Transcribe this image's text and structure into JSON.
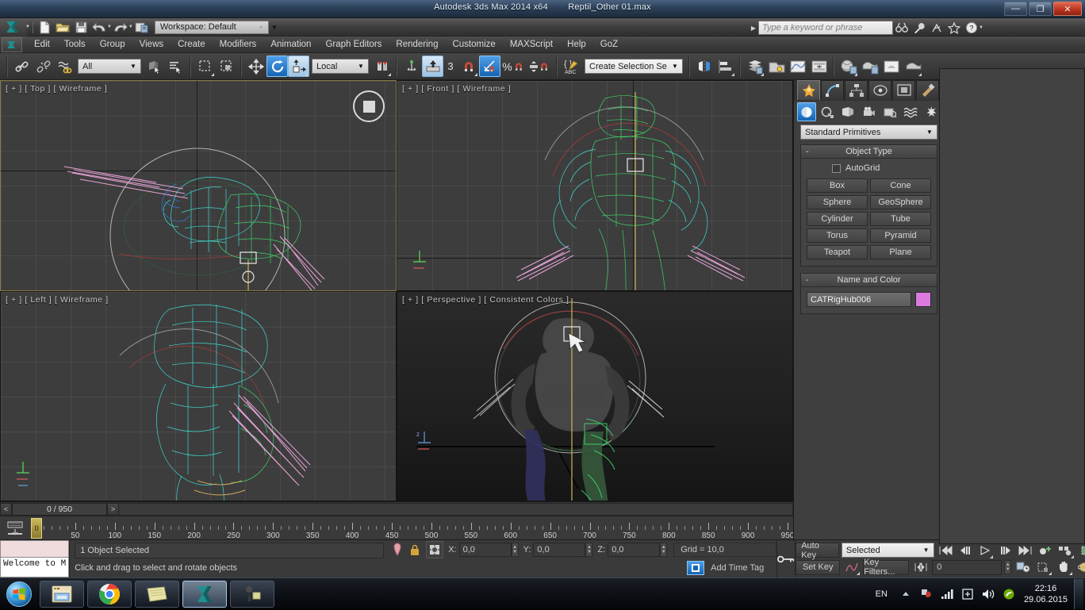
{
  "window": {
    "title_app": "Autodesk 3ds Max  2014 x64",
    "title_file": "Reptil_Other 01.max",
    "minimize_label": "—",
    "restore_label": "❐",
    "close_label": "✕"
  },
  "quick_access": {
    "workspace_label": "Workspace: Default",
    "workspace_dash": "-",
    "icons": [
      "new-file-icon",
      "open-file-icon",
      "save-icon",
      "undo-icon",
      "redo-icon",
      "project-folder-icon"
    ],
    "search_placeholder": "Type a keyword or phrase",
    "search_value": "",
    "right_icons": [
      "binoculars-icon",
      "wrench-icon",
      "subscription-icon",
      "favorites-star-icon",
      "help-icon"
    ]
  },
  "menu": {
    "items": [
      "Edit",
      "Tools",
      "Group",
      "Views",
      "Create",
      "Modifiers",
      "Animation",
      "Graph Editors",
      "Rendering",
      "Customize",
      "MAXScript",
      "Help",
      "GoZ"
    ]
  },
  "toolbar": {
    "selection_filter": "All",
    "reference_coord": "Local",
    "named_selection_sets": "Create Selection Se",
    "angle_snap_value": "3",
    "percent_label": "%",
    "icons": [
      "select-and-link-icon",
      "unlink-selection-icon",
      "bind-to-space-warp-icon",
      "select-object-icon",
      "select-by-name-icon",
      "rectangular-selection-region-icon",
      "window-crossing-icon",
      "select-and-move-icon",
      "select-and-rotate-icon",
      "select-and-scale-icon",
      "use-center-flyout-icon",
      "select-and-manipulate-icon",
      "snaps-toggle-icon",
      "angle-snap-toggle-icon",
      "percent-snap-toggle-icon",
      "spinner-snap-toggle-icon",
      "edit-named-selection-sets-icon",
      "mirror-icon",
      "align-icon",
      "layer-manager-icon",
      "graphite-modeling-icon",
      "curve-editor-icon",
      "schematic-view-icon",
      "material-editor-icon",
      "render-setup-icon",
      "rendered-frame-window-icon",
      "render-production-icon"
    ]
  },
  "viewports": [
    {
      "name": "viewport-top",
      "label": "[ + ] [ Top ] [ Wireframe ]",
      "active": true
    },
    {
      "name": "viewport-front",
      "label": "[ + ] [ Front ] [ Wireframe ]",
      "active": false
    },
    {
      "name": "viewport-left",
      "label": "[ + ] [ Left ] [ Wireframe ]",
      "active": false
    },
    {
      "name": "viewport-perspective",
      "label": "[ + ] [ Perspective ] [ Consistent Colors ]",
      "active": false
    }
  ],
  "command_panel": {
    "tabs": [
      "create-tab",
      "modify-tab",
      "hierarchy-tab",
      "motion-tab",
      "display-tab",
      "utilities-tab"
    ],
    "categories": [
      "geometry-category",
      "shapes-category",
      "lights-category",
      "cameras-category",
      "helpers-category",
      "space-warps-category",
      "systems-category"
    ],
    "subcategory": "Standard Primitives",
    "object_type": {
      "header": "Object Type",
      "collapse_glyph": "-",
      "autogrid_label": "AutoGrid",
      "autogrid_checked": false,
      "buttons": [
        "Box",
        "Cone",
        "Sphere",
        "GeoSphere",
        "Cylinder",
        "Tube",
        "Torus",
        "Pyramid",
        "Teapot",
        "Plane"
      ]
    },
    "name_and_color": {
      "header": "Name and Color",
      "collapse_glyph": "-",
      "object_name": "CATRigHub006",
      "color": "#dd7ae0"
    }
  },
  "track_bar": {
    "prev_label": "<",
    "next_label": ">",
    "frame_display": "0 / 950"
  },
  "timeline": {
    "start": 0,
    "end": 950,
    "major_labels": [
      0,
      50,
      100,
      150,
      200,
      250,
      300,
      350,
      400,
      450,
      500,
      550,
      600,
      650,
      700,
      750,
      800,
      850,
      900,
      950
    ],
    "slider_frame": "0",
    "key_mode_icon": "set-key-mode-icon"
  },
  "status_bar": {
    "listener_text": "Welcome to M",
    "selection_status": "1 Object Selected",
    "prompt": "Click and drag to select and rotate objects",
    "x_label": "X:",
    "x_value": "0,0",
    "y_label": "Y:",
    "y_value": "0,0",
    "z_label": "Z:",
    "z_value": "0,0",
    "grid_info": "Grid = 10,0",
    "add_time_tag": "Add Time Tag",
    "isolate_icon": "isolate-selection-icon",
    "lock_icon": "selection-lock-icon",
    "absolute_mode_icon": "absolute-relative-toggle-icon",
    "key_icon": "key-icon"
  },
  "animation_controls": {
    "auto_key": "Auto Key",
    "set_key": "Set Key",
    "key_mode_filter": "Selected",
    "key_filters": "Key Filters...",
    "current_frame": "0",
    "transport_icons": [
      "go-to-start-icon",
      "previous-frame-icon",
      "play-animation-icon",
      "next-frame-icon",
      "go-to-end-icon"
    ],
    "key_icons": [
      "set-keys-icon",
      "key-mode-toggle-icon",
      "time-configuration-icon"
    ],
    "nav_icons": [
      "zoom-icon",
      "zoom-all-icon",
      "zoom-extents-icon",
      "zoom-region-icon",
      "pan-view-icon",
      "orbit-icon",
      "maximize-viewport-toggle-icon"
    ]
  },
  "taskbar": {
    "start_label": "start-orb-icon",
    "items": [
      "windows-explorer-icon",
      "google-chrome-icon",
      "notepad-icon",
      "3ds-max-icon",
      "zbrush-icon"
    ],
    "active_index": 3,
    "language": "EN",
    "tray_icons": [
      "show-hidden-icons-icon",
      "security-icon",
      "network-icon",
      "action-center-icon",
      "volume-icon",
      "nvidia-icon"
    ],
    "time": "22:16",
    "date": "29.06.2015"
  },
  "colors": {
    "accent_blue": "#1f7fd4",
    "title_blue": "#2c4058",
    "panel_gray": "#3f3f3f",
    "viewport_gray": "#3d3d3d",
    "object_pink": "#dd7ae0",
    "wire_cyan": "#3fe0d8",
    "wire_green": "#3fd86a"
  }
}
